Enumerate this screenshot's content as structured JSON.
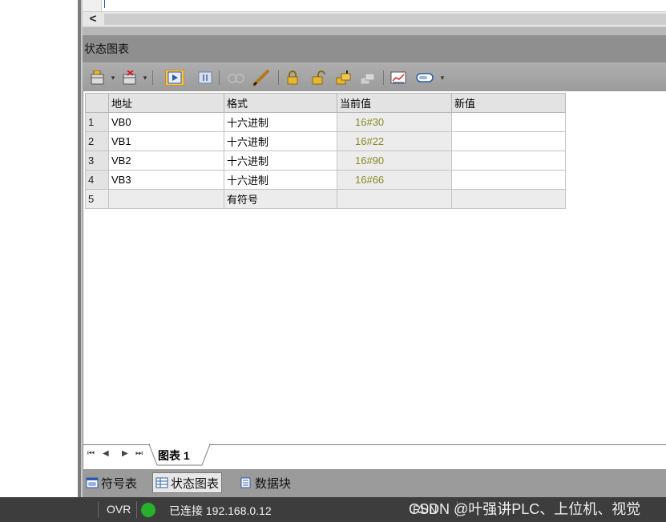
{
  "editor": {
    "scroll_left_glyph": "<"
  },
  "panel": {
    "title": "状态图表"
  },
  "toolbar": {
    "buttons": [
      "insert-row-icon",
      "delete-row-icon",
      "monitor-start-icon",
      "monitor-pause-icon",
      "graph-disabled-icon",
      "write-pencil-icon",
      "force-lock-icon",
      "unforce-icon",
      "force-all-icon",
      "read-all-icon",
      "trend-chart-icon",
      "tag-icon"
    ]
  },
  "grid": {
    "headers": {
      "row": "",
      "address": "地址",
      "format": "格式",
      "current": "当前值",
      "new": "新值"
    },
    "rows": [
      {
        "num": "1",
        "address": "VB0",
        "format": "十六进制",
        "current": "16#30",
        "new": ""
      },
      {
        "num": "2",
        "address": "VB1",
        "format": "十六进制",
        "current": "16#22",
        "new": ""
      },
      {
        "num": "3",
        "address": "VB2",
        "format": "十六进制",
        "current": "16#90",
        "new": ""
      },
      {
        "num": "4",
        "address": "VB3",
        "format": "十六进制",
        "current": "16#66",
        "new": ""
      },
      {
        "num": "5",
        "address": "",
        "format": "有符号",
        "current": "",
        "new": ""
      }
    ]
  },
  "sheet_tabs": {
    "nav": [
      "⏮",
      "◀",
      "▶",
      "⏭"
    ],
    "active": "图表 1"
  },
  "bottom_tabs": [
    {
      "label": "符号表",
      "active": false
    },
    {
      "label": "状态图表",
      "active": true
    },
    {
      "label": "数据块",
      "active": false
    }
  ],
  "status_bar": {
    "ovr": "OVR",
    "connection": "已连接 192.168.0.12",
    "mode": "RUN",
    "connected_color": "#25b12b"
  },
  "watermark": "CSDN @叶强讲PLC、上位机、视觉"
}
